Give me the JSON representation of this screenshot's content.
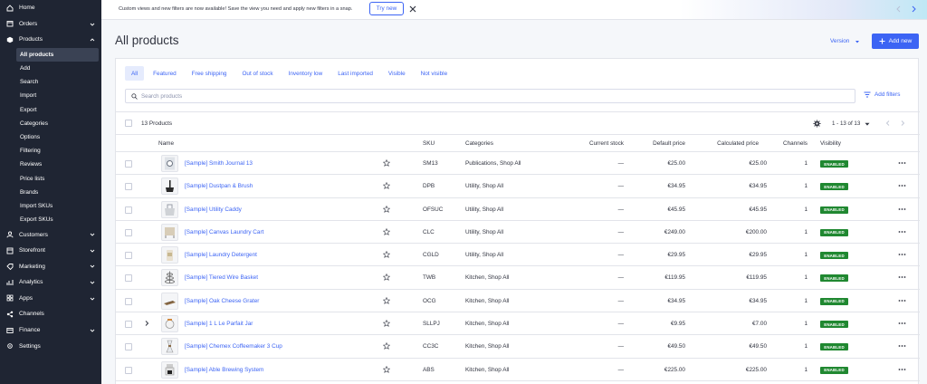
{
  "sidebar": {
    "items": [
      {
        "label": "Home",
        "icon": "home-icon",
        "chevron": false
      },
      {
        "label": "Orders",
        "icon": "orders-icon",
        "chevron": true
      },
      {
        "label": "Products",
        "icon": "products-icon",
        "chevron": true,
        "expanded": true
      }
    ],
    "sub_items": [
      "All products",
      "Add",
      "Search",
      "Import",
      "Export",
      "Categories",
      "Options",
      "Filtering",
      "Reviews",
      "Price lists",
      "Brands",
      "Import SKUs",
      "Export SKUs"
    ],
    "items_after": [
      {
        "label": "Customers",
        "icon": "customers-icon",
        "chevron": true
      },
      {
        "label": "Storefront",
        "icon": "storefront-icon",
        "chevron": true
      },
      {
        "label": "Marketing",
        "icon": "marketing-icon",
        "chevron": true
      },
      {
        "label": "Analytics",
        "icon": "analytics-icon",
        "chevron": true
      },
      {
        "label": "Apps",
        "icon": "apps-icon",
        "chevron": true
      },
      {
        "label": "Channels",
        "icon": "channels-icon",
        "chevron": false
      },
      {
        "label": "Finance",
        "icon": "finance-icon",
        "chevron": true
      },
      {
        "label": "Settings",
        "icon": "settings-icon",
        "chevron": false
      }
    ]
  },
  "banner": {
    "text": "Custom views and new filters are now available! Save the view you need and apply new filters in a snap.",
    "button": "Try new"
  },
  "header": {
    "title": "All products",
    "version_label": "Version",
    "add_new_label": "Add new"
  },
  "tabs": [
    "All",
    "Featured",
    "Free shipping",
    "Out of stock",
    "Inventory low",
    "Last imported",
    "Visible",
    "Not visible"
  ],
  "search": {
    "placeholder": "Search products",
    "value": ""
  },
  "filters_label": "Add filters",
  "toolbar": {
    "count": "13 Products",
    "pagination": "1 - 13 of 13"
  },
  "columns": {
    "name": "Name",
    "sku": "SKU",
    "categories": "Categories",
    "stock": "Current stock",
    "default_price": "Default price",
    "calculated_price": "Calculated price",
    "channels": "Channels",
    "visibility": "Visibility"
  },
  "rows": [
    {
      "name": "[Sample] Smith Journal 13",
      "sku": "SM13",
      "categories": "Publications, Shop All",
      "stock": "—",
      "default_price": "€25.00",
      "calculated_price": "€25.00",
      "channels": "1",
      "visibility": "ENABLED",
      "thumb": "journal"
    },
    {
      "name": "[Sample] Dustpan & Brush",
      "sku": "DPB",
      "categories": "Utility, Shop All",
      "stock": "—",
      "default_price": "€34.95",
      "calculated_price": "€34.95",
      "channels": "1",
      "visibility": "ENABLED",
      "thumb": "dustpan"
    },
    {
      "name": "[Sample] Utility Caddy",
      "sku": "OFSUC",
      "categories": "Utility, Shop All",
      "stock": "—",
      "default_price": "€45.95",
      "calculated_price": "€45.95",
      "channels": "1",
      "visibility": "ENABLED",
      "thumb": "caddy"
    },
    {
      "name": "[Sample] Canvas Laundry Cart",
      "sku": "CLC",
      "categories": "Utility, Shop All",
      "stock": "—",
      "default_price": "€249.00",
      "calculated_price": "€200.00",
      "channels": "1",
      "visibility": "ENABLED",
      "thumb": "cart"
    },
    {
      "name": "[Sample] Laundry Detergent",
      "sku": "CGLD",
      "categories": "Utility, Shop All",
      "stock": "—",
      "default_price": "€29.95",
      "calculated_price": "€29.95",
      "channels": "1",
      "visibility": "ENABLED",
      "thumb": "detergent"
    },
    {
      "name": "[Sample] Tiered Wire Basket",
      "sku": "TWB",
      "categories": "Kitchen, Shop All",
      "stock": "—",
      "default_price": "€119.95",
      "calculated_price": "€119.95",
      "channels": "1",
      "visibility": "ENABLED",
      "thumb": "basket"
    },
    {
      "name": "[Sample] Oak Cheese Grater",
      "sku": "OCG",
      "categories": "Kitchen, Shop All",
      "stock": "—",
      "default_price": "€34.95",
      "calculated_price": "€34.95",
      "channels": "1",
      "visibility": "ENABLED",
      "thumb": "grater"
    },
    {
      "name": "[Sample] 1 L Le Parfait Jar",
      "sku": "SLLPJ",
      "categories": "Kitchen, Shop All",
      "stock": "—",
      "default_price": "€9.95",
      "calculated_price": "€7.00",
      "channels": "1",
      "visibility": "ENABLED",
      "thumb": "jar",
      "expandable": true
    },
    {
      "name": "[Sample] Chemex Coffeemaker 3 Cup",
      "sku": "CC3C",
      "categories": "Kitchen, Shop All",
      "stock": "—",
      "default_price": "€49.50",
      "calculated_price": "€49.50",
      "channels": "1",
      "visibility": "ENABLED",
      "thumb": "chemex"
    },
    {
      "name": "[Sample] Able Brewing System",
      "sku": "ABS",
      "categories": "Kitchen, Shop All",
      "stock": "—",
      "default_price": "€225.00",
      "calculated_price": "€225.00",
      "channels": "1",
      "visibility": "ENABLED",
      "thumb": "brewer"
    }
  ],
  "colors": {
    "accent": "#3c64f4",
    "sidebar_bg": "#1f2533",
    "enabled_badge": "#208831"
  }
}
